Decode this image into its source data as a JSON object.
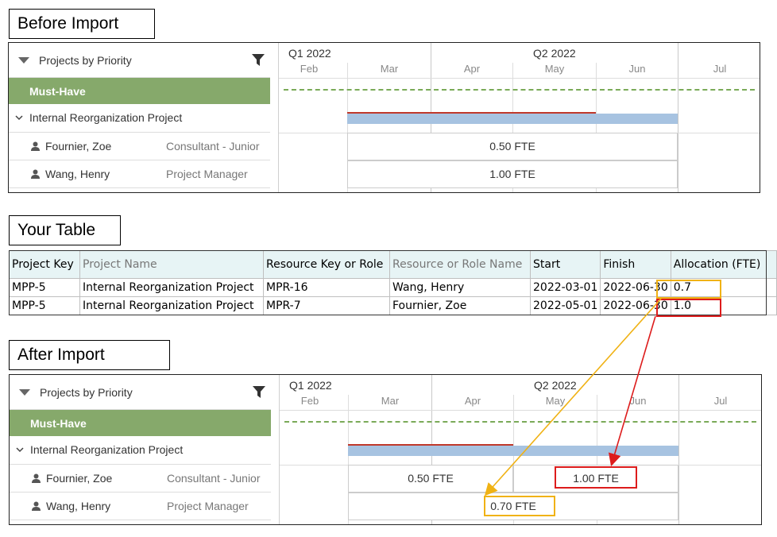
{
  "labels": {
    "before": "Before Import",
    "table": "Your Table",
    "after": "After Import"
  },
  "gantt": {
    "group_header": "Projects by Priority",
    "priority": "Must-Have",
    "project": "Internal Reorganization Project",
    "resources": [
      {
        "name": "Fournier, Zoe",
        "role": "Consultant - Junior"
      },
      {
        "name": "Wang, Henry",
        "role": "Project Manager"
      }
    ],
    "quarters": [
      "Q1 2022",
      "Q2 2022"
    ],
    "months": [
      "Feb",
      "Mar",
      "Apr",
      "May",
      "Jun",
      "Jul"
    ]
  },
  "before": {
    "zoe_fte": "0.50 FTE",
    "henry_fte": "1.00 FTE"
  },
  "after": {
    "zoe_fte_1": "0.50 FTE",
    "zoe_fte_2": "1.00 FTE",
    "henry_fte": "0.70 FTE"
  },
  "table": {
    "headers": [
      "Project Key",
      "Project Name",
      "Resource Key or Role",
      "Resource or Role Name",
      "Start",
      "Finish",
      "Allocation (FTE)"
    ],
    "rows": [
      [
        "MPP-5",
        "Internal Reorganization Project",
        "MPR-16",
        "Wang, Henry",
        "2022-03-01",
        "2022-06-30",
        "0.7"
      ],
      [
        "MPP-5",
        "Internal Reorganization Project",
        "MPR-7",
        "Fournier, Zoe",
        "2022-05-01",
        "2022-06-30",
        "1.0"
      ]
    ]
  },
  "colors": {
    "must_have": "#86a96b",
    "highlight_yellow": "#f0b214",
    "highlight_red": "#dd1c1c",
    "bar_blue": "#a7c3e1",
    "bar_red": "#c0392b"
  }
}
